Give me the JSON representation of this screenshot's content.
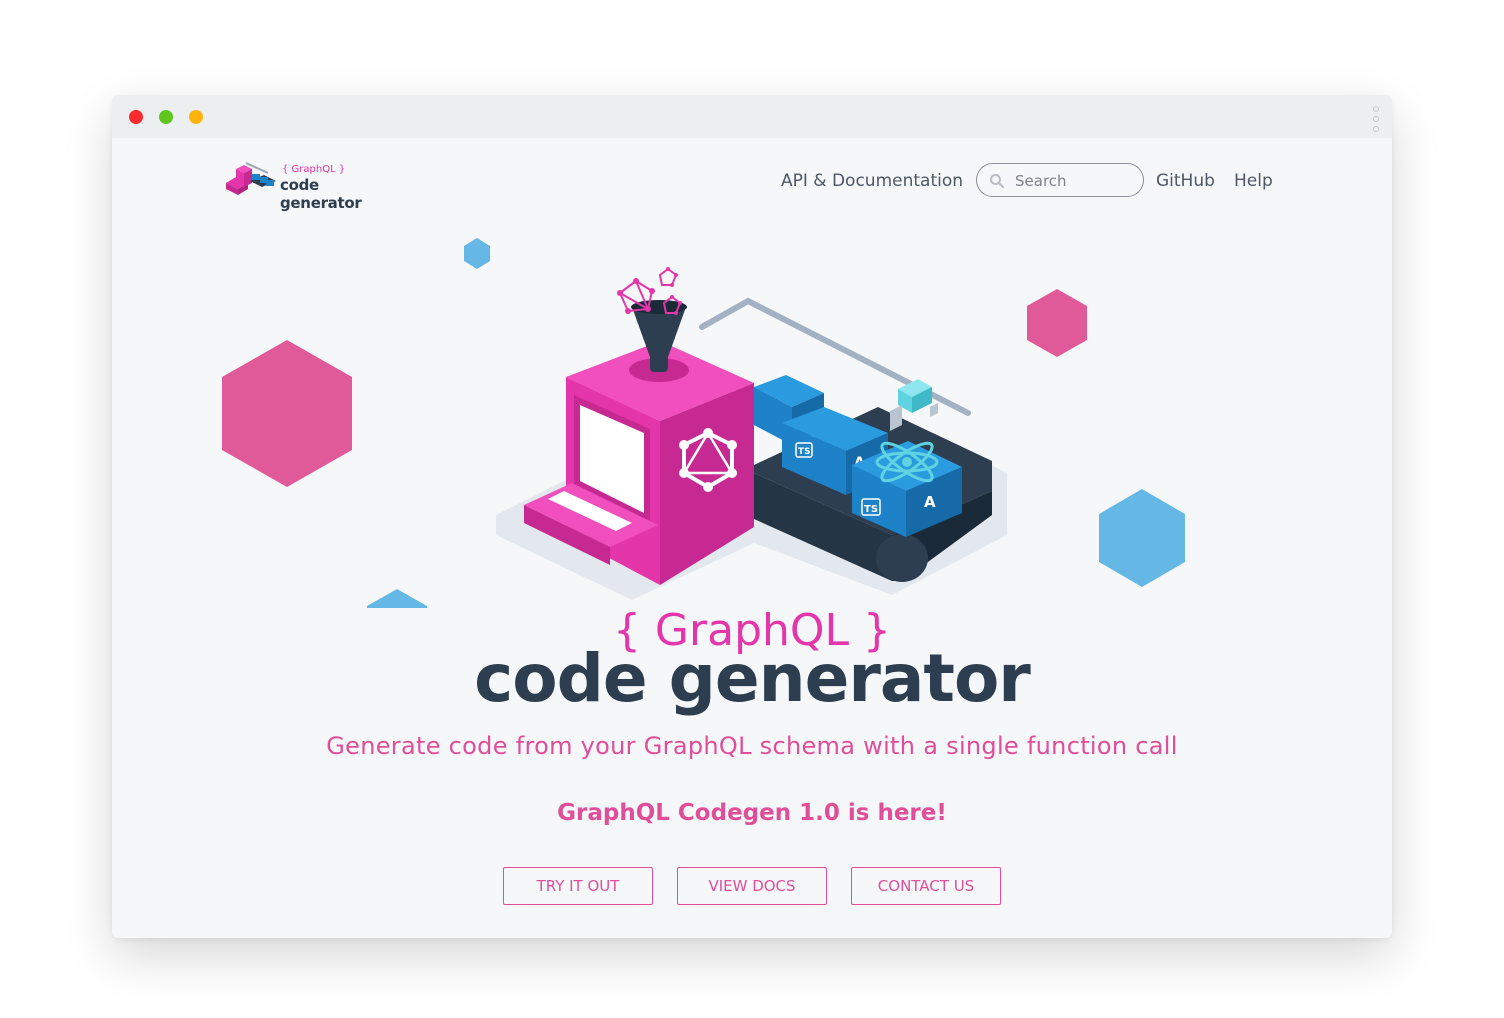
{
  "browser": {
    "controls": [
      "close",
      "minimize",
      "maximize"
    ],
    "menu_icon": "kebab-menu-icon"
  },
  "header": {
    "logo": {
      "small_text": "{ GraphQL }",
      "main_text": "code generator"
    },
    "nav": {
      "api_docs": "API & Documentation",
      "github": "GitHub",
      "help": "Help"
    },
    "search": {
      "placeholder": "Search",
      "value": "",
      "icon": "search-icon"
    }
  },
  "hero": {
    "eyebrow": "{ GraphQL }",
    "title": "code generator",
    "tagline": "Generate code from your GraphQL schema with a single function call",
    "announcement": "GraphQL Codegen 1.0 is here!",
    "illustration_labels": {
      "typescript": "TS",
      "angular": "A"
    }
  },
  "actions": {
    "try": "TRY IT OUT",
    "docs": "VIEW DOCS",
    "contact": "CONTACT US"
  },
  "colors": {
    "brand_pink": "#e535ab",
    "text_pink": "#e04e9a",
    "navy": "#2d3e50",
    "hex_pink": "#e05a9a",
    "hex_blue": "#65b8e6",
    "block_blue": "#1e82c8"
  }
}
